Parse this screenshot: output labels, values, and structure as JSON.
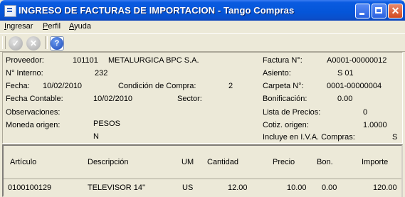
{
  "window": {
    "title": "INGRESO DE FACTURAS DE IMPORTACION - Tango Compras",
    "close_glyph": "✕"
  },
  "menu": [
    {
      "label": "Ingresar"
    },
    {
      "label": "Perfil"
    },
    {
      "label": "Ayuda"
    }
  ],
  "toolbar": {
    "ok_glyph": "✓",
    "cancel_glyph": "✕",
    "help_glyph": "?"
  },
  "header": {
    "proveedor_label": "Proveedor:",
    "proveedor_codigo": "101101",
    "proveedor_nombre": "METALURGICA BPC S.A.",
    "interno_label": "N° Interno:",
    "interno_value": "232",
    "fecha_label": "Fecha:",
    "fecha_value": "10/02/2010",
    "condicion_label": "Condición de Compra:",
    "condicion_value": "2",
    "fecha_contable_label": "Fecha Contable:",
    "fecha_contable_value": "10/02/2010",
    "sector_label": "Sector:",
    "observaciones_label": "Observaciones:",
    "moneda_label": "Moneda origen:",
    "moneda_value": "PESOS",
    "moneda_value2": "N",
    "factura_label": "Factura N°:",
    "factura_value": "A0001-00000012",
    "asiento_label": "Asiento:",
    "asiento_value": "S  01",
    "carpeta_label": "Carpeta N°:",
    "carpeta_value": "0001-00000004",
    "bonificacion_label": "Bonificación:",
    "bonificacion_value": "0.00",
    "lista_label": "Lista de Precios:",
    "lista_value": "0",
    "cotiz_label": "Cotiz. origen:",
    "cotiz_value": "1.0000",
    "iva_label": "Incluye en I.V.A. Compras:",
    "iva_value": "S"
  },
  "grid": {
    "columns": [
      "Artículo",
      "Descripción",
      "UM",
      "Cantidad",
      "Precio",
      "Bon.",
      "Importe"
    ],
    "rows": [
      [
        "0100100129",
        "TELEVISOR 14''",
        "US",
        "12.00",
        "10.00",
        "0.00",
        "120.00"
      ]
    ]
  }
}
